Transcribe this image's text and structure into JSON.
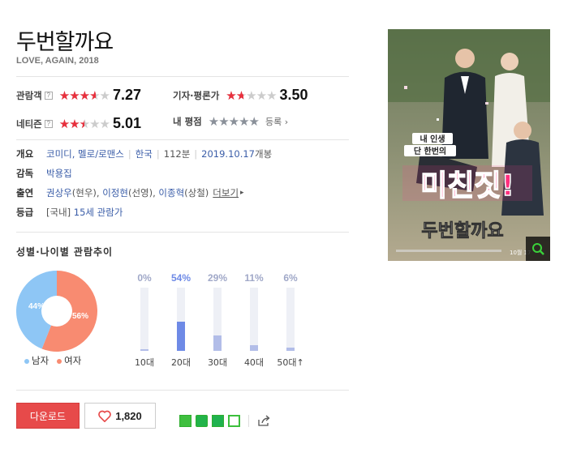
{
  "movie": {
    "title": "두번할까요",
    "subtitle": "LOVE, AGAIN, 2018"
  },
  "scores": {
    "audience": {
      "label": "관람객",
      "help": "?",
      "value": "7.27",
      "rating": 0.727
    },
    "critic": {
      "label": "기자·평론가",
      "value": "3.50",
      "rating": 0.35
    },
    "netizen": {
      "label": "네티즌",
      "help": "?",
      "value": "5.01",
      "rating": 0.501
    },
    "mine": {
      "label": "내 평점",
      "register": "등록"
    }
  },
  "info": {
    "overview_label": "개요",
    "genres": "코미디, 멜로/로맨스",
    "country": "한국",
    "runtime": "112분",
    "release": "2019.10.17",
    "release_suffix": "개봉",
    "director_label": "감독",
    "director": "박용집",
    "cast_label": "출연",
    "cast": [
      {
        "name": "권상우",
        "role": "(현우)"
      },
      {
        "name": "이정현",
        "role": "(선영)"
      },
      {
        "name": "이종혁",
        "role": "(상철)"
      }
    ],
    "more": "더보기",
    "rating_label": "등급",
    "rating_prefix": "[국내]",
    "rating_value": "15세 관람가"
  },
  "trend": {
    "title": "성별·나이별 관람추이",
    "gender": {
      "male_pct": 44,
      "female_pct": 56,
      "male_label": "44%",
      "female_label": "56%"
    },
    "legend": {
      "male": "남자",
      "female": "여자"
    },
    "ages": [
      {
        "label": "10대",
        "pct_text": "0%",
        "pct": 0
      },
      {
        "label": "20대",
        "pct_text": "54%",
        "pct": 54
      },
      {
        "label": "30대",
        "pct_text": "29%",
        "pct": 29
      },
      {
        "label": "40대",
        "pct_text": "11%",
        "pct": 11
      },
      {
        "label": "50대↑",
        "pct_text": "6%",
        "pct": 6
      }
    ]
  },
  "actions": {
    "download": "다운로드",
    "likes": "1,820"
  },
  "poster": {
    "tagline1": "내 인생",
    "tagline2": "단 한번의",
    "headline": "미친짓!",
    "title": "두번할까요",
    "date": "10월 17"
  },
  "colors": {
    "star_red": "#e8303d",
    "star_gray": "#cccccc",
    "male": "#8ec6f5",
    "female": "#f88b71",
    "bar_main": "#6e8ae6",
    "bar_light": "#b2bde8",
    "download": "#e74a4a"
  },
  "icons": [
    "help-icon",
    "chevron-right-icon",
    "heart-icon",
    "blog-share-icon",
    "band-share-icon",
    "bookmark-share-icon",
    "green-share-icon",
    "share-icon",
    "search-icon"
  ]
}
